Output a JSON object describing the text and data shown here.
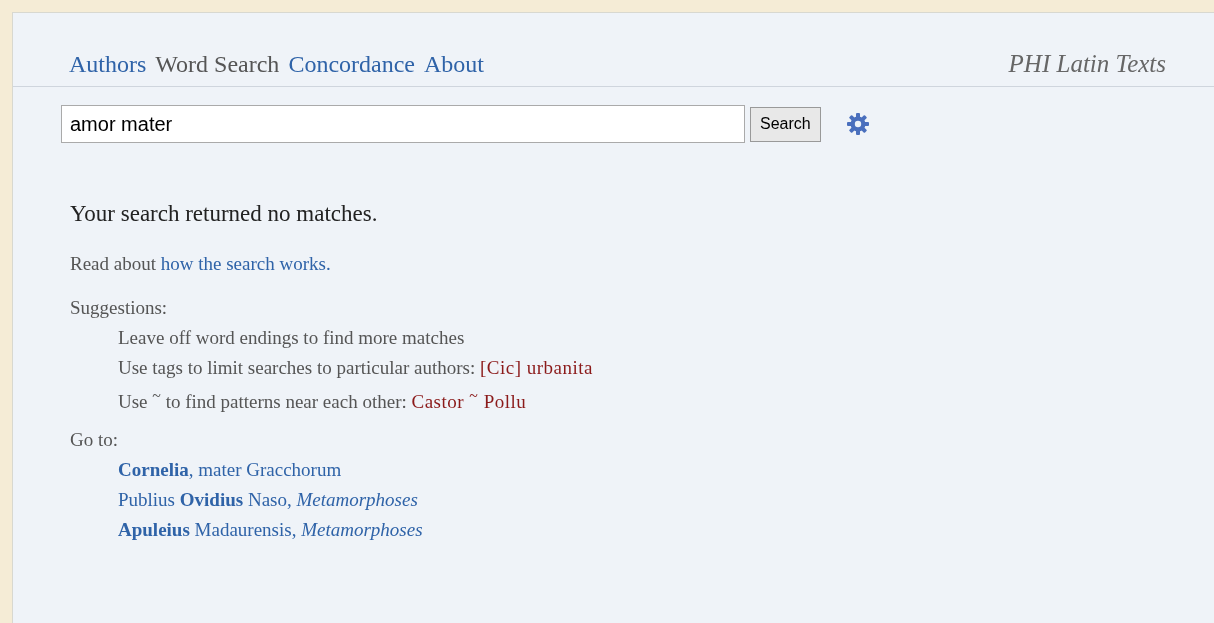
{
  "nav": {
    "tabs": [
      {
        "label": "Authors",
        "selected": false
      },
      {
        "label": "Word Search",
        "selected": true
      },
      {
        "label": "Concordance",
        "selected": false
      },
      {
        "label": "About",
        "selected": false
      }
    ],
    "site_title": "PHI Latin Texts"
  },
  "search": {
    "value": "amor mater",
    "button": "Search"
  },
  "result_message": "Your search returned no matches.",
  "help": {
    "text": "Read about",
    "link": "how the search works."
  },
  "suggestions": {
    "heading": "Suggestions:",
    "items": [
      {
        "text": "Leave off word endings to find more matches"
      },
      {
        "text": "Use tags to limit searches to particular authors:",
        "example": "[Cic] urbanita"
      },
      {
        "text": "Use $^{~}$ to find patterns near each other:",
        "example": "Castor $^{~}$ Pollu"
      }
    ]
  },
  "goto": {
    "heading": "Go to:",
    "links": [
      "**Cornelia**, mater Gracchorum",
      "Publius **Ovidius** Naso, *Metamorphoses*",
      "**Apuleius** Madaurensis, *Metamorphoses*"
    ]
  }
}
